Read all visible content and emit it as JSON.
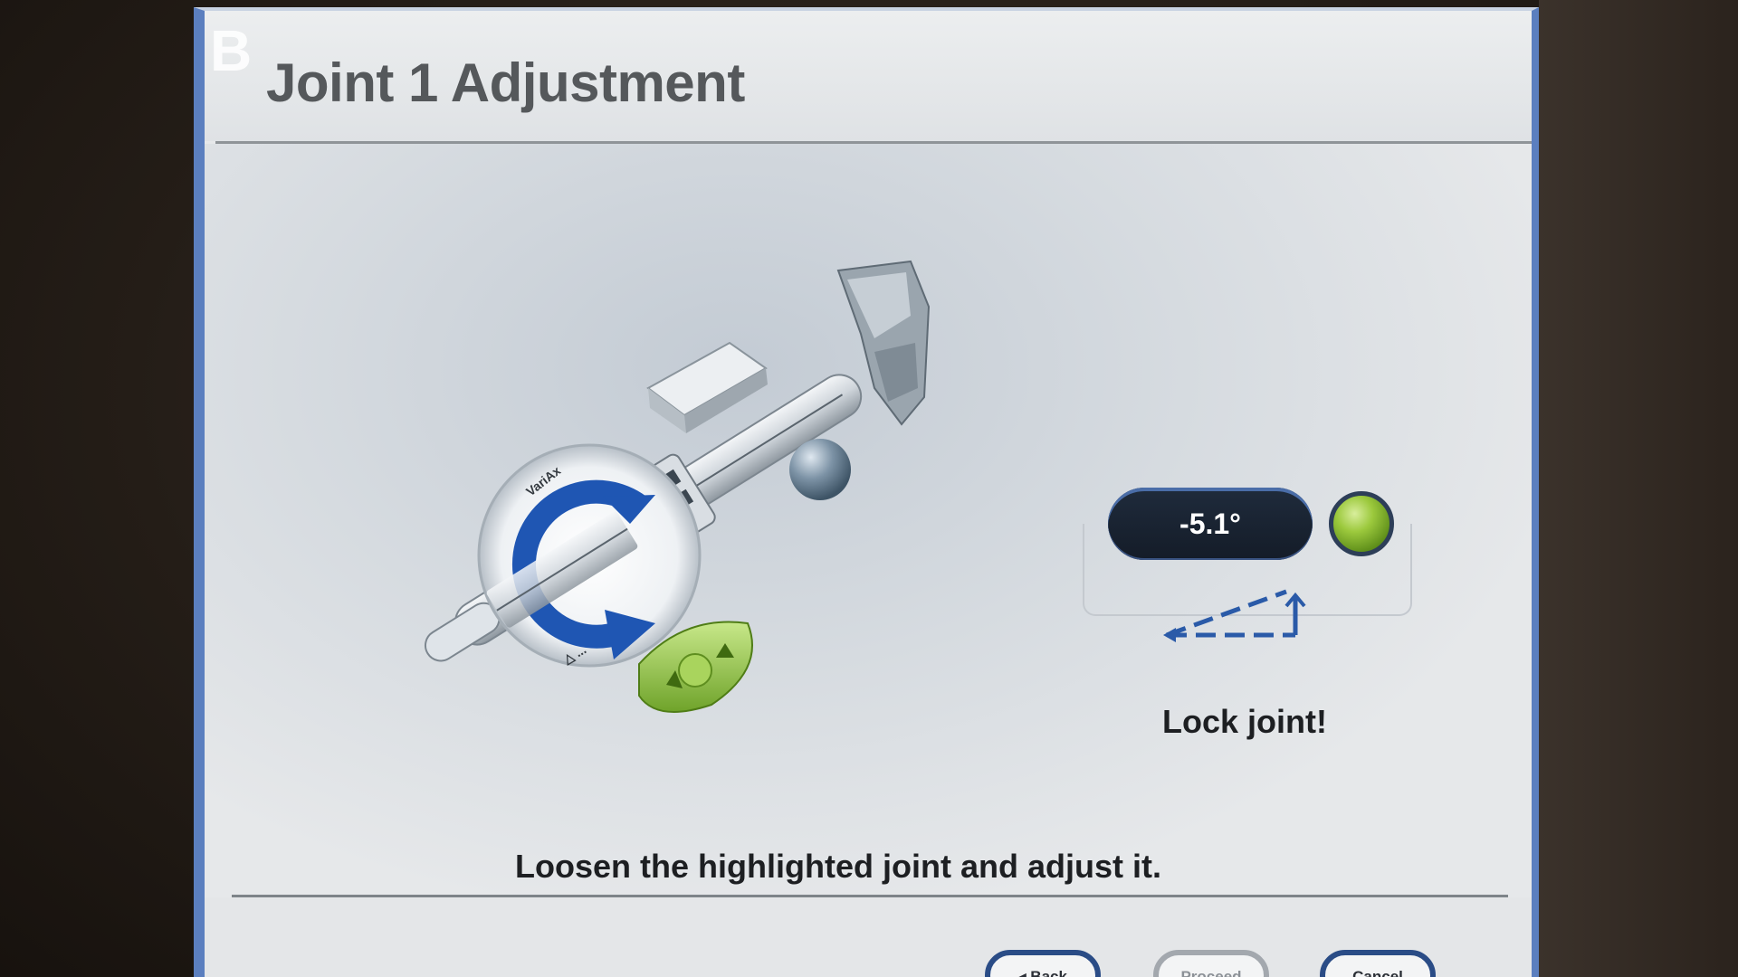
{
  "header": {
    "step_letter": "B",
    "title": "Joint 1 Adjustment"
  },
  "readout": {
    "angle_value": "-5.1°",
    "status_color": "#8fc63a",
    "status_icon": "green-status-led",
    "angle_icon": "angle-indicator-icon"
  },
  "instructions": {
    "side": "Lock joint!",
    "main": "Loosen the highlighted joint and adjust it."
  },
  "navigation": {
    "back_label": "◂ Back",
    "proceed_label": "Proceed",
    "cancel_label": "Cancel"
  },
  "illustration": {
    "icon": "joint-adjustment-illustration",
    "dial_text_top": "VariAx",
    "dial_text_bottom": "△ ..."
  },
  "colors": {
    "accent_blue": "#1f56b3",
    "frame_blue": "#5b7fbf",
    "readout_bg": "#172231",
    "highlight_green": "#8fc63a"
  }
}
